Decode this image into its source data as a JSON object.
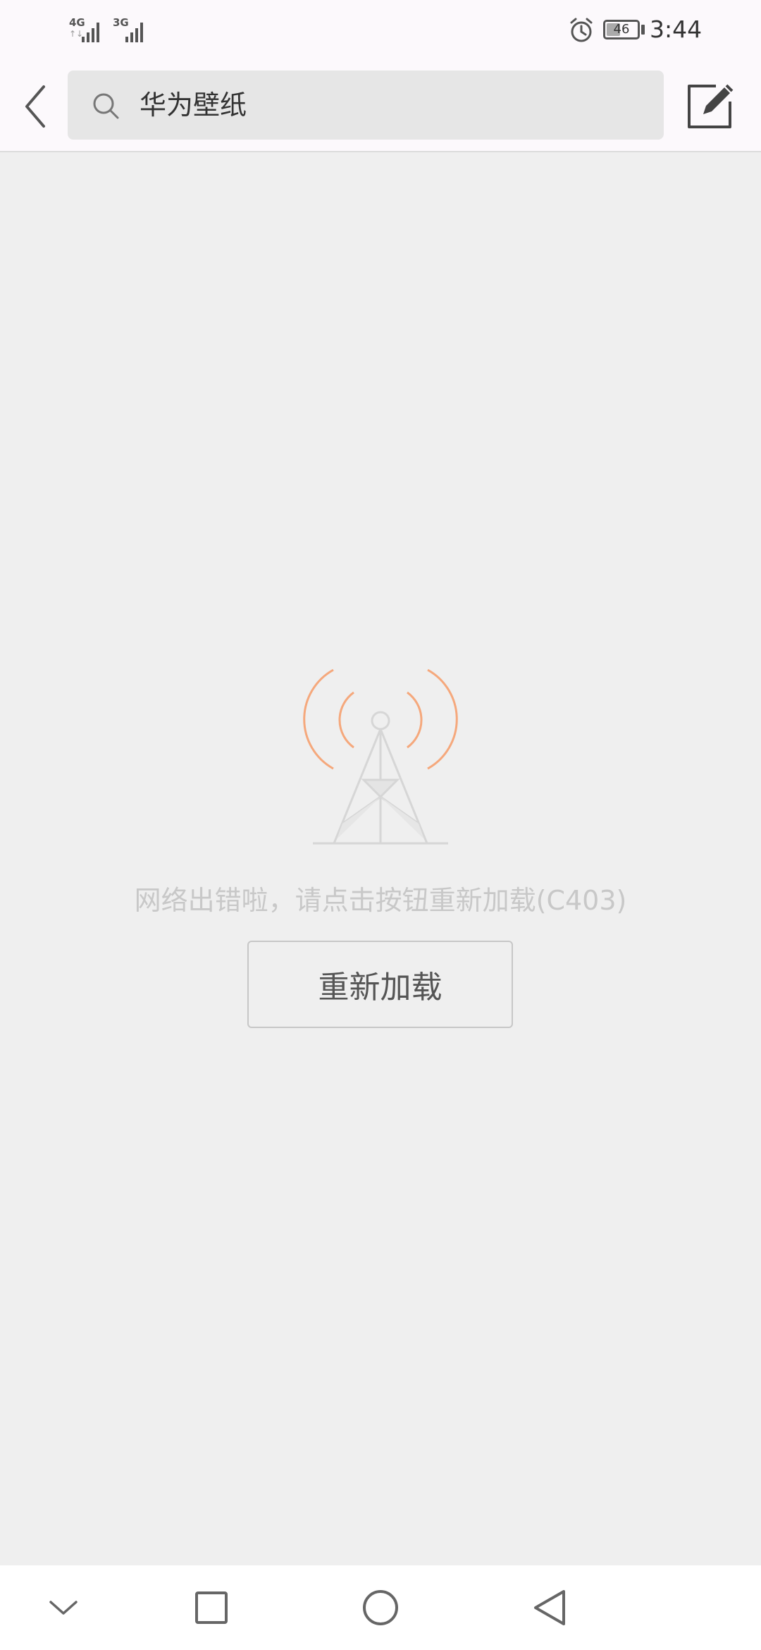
{
  "status_bar": {
    "network1": "4G",
    "network1_sub": "↑↓",
    "network2": "3G",
    "battery_level": "46",
    "battery_fraction": 0.46,
    "time": "3:44",
    "icons": [
      "signal-icon",
      "alarm-icon",
      "battery-icon"
    ]
  },
  "top_bar": {
    "search_query": "华为壁纸",
    "icons": [
      "back-chevron-icon",
      "search-icon",
      "edit-icon"
    ]
  },
  "error": {
    "message": "网络出错啦，请点击按钮重新加载(C403)",
    "reload_label": "重新加载",
    "illustration_icon": "signal-tower-icon",
    "accent_color": "#f5a87c"
  },
  "nav_bar": {
    "icons": [
      "chevron-down-icon",
      "square-icon",
      "circle-icon",
      "triangle-back-icon"
    ]
  }
}
